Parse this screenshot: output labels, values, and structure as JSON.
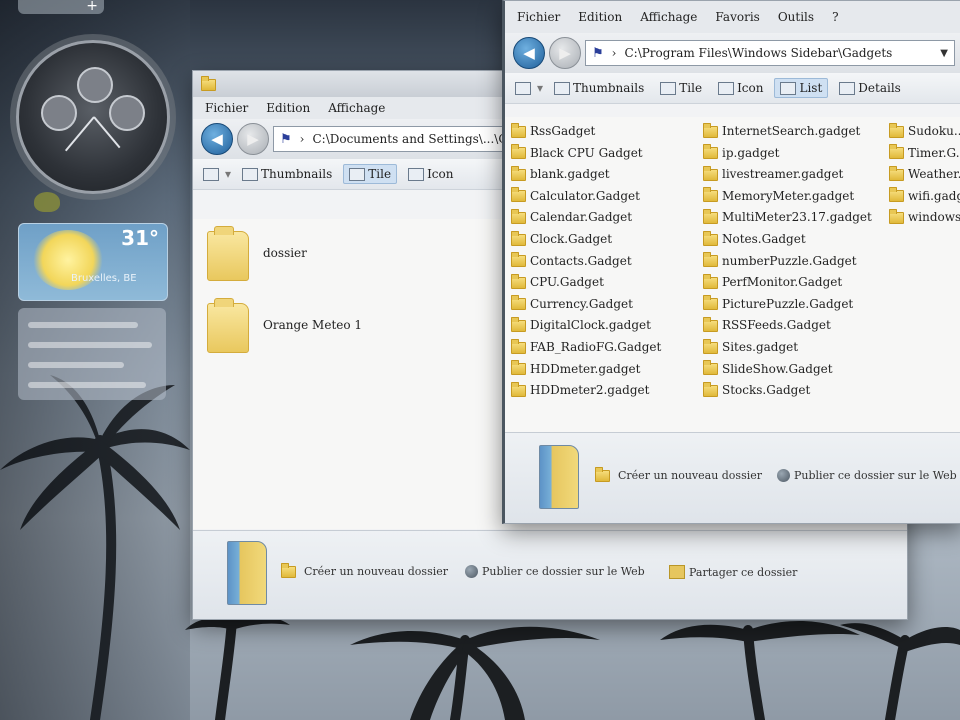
{
  "sidebar": {
    "weather": {
      "temp": "31°",
      "city": "Bruxelles, BE"
    }
  },
  "window_left": {
    "menu": [
      "Fichier",
      "Edition",
      "Affichage"
    ],
    "address": "C:\\Documents and Settings\\...\\Gadgets",
    "toolbar": {
      "thumbnails": "Thumbnails",
      "tile": "Tile",
      "icon": "Icon"
    },
    "items": [
      "dossier",
      "Orange Meteo 1"
    ],
    "tasks": {
      "new_folder": "Créer un nouveau dossier",
      "publish": "Publier ce dossier sur le Web",
      "share": "Partager ce dossier"
    }
  },
  "window_right": {
    "menu": [
      "Fichier",
      "Edition",
      "Affichage",
      "Favoris",
      "Outils",
      "?"
    ],
    "address": "C:\\Program Files\\Windows Sidebar\\Gadgets",
    "toolbar": {
      "thumbnails": "Thumbnails",
      "tile": "Tile",
      "icon": "Icon",
      "list": "List",
      "details": "Details"
    },
    "col1": [
      "RssGadget",
      "Black CPU Gadget",
      "blank.gadget",
      "Calculator.Gadget",
      "Calendar.Gadget",
      "Clock.Gadget",
      "Contacts.Gadget",
      "CPU.Gadget",
      "Currency.Gadget",
      "DigitalClock.gadget",
      "FAB_RadioFG.Gadget",
      "HDDmeter.gadget",
      "HDDmeter2.gadget"
    ],
    "col2": [
      "InternetSearch.gadget",
      "ip.gadget",
      "livestreamer.gadget",
      "MemoryMeter.gadget",
      "MultiMeter23.17.gadget",
      "Notes.Gadget",
      "numberPuzzle.Gadget",
      "PerfMonitor.Gadget",
      "PicturePuzzle.Gadget",
      "RSSFeeds.Gadget",
      "Sites.gadget",
      "SlideShow.Gadget",
      "Stocks.Gadget"
    ],
    "col3": [
      "Sudoku...",
      "Timer.G...",
      "Weather...",
      "wifi.gadg...",
      "windows..."
    ],
    "tasks": {
      "new_folder": "Créer un nouveau dossier",
      "publish": "Publier ce dossier sur le Web"
    }
  }
}
